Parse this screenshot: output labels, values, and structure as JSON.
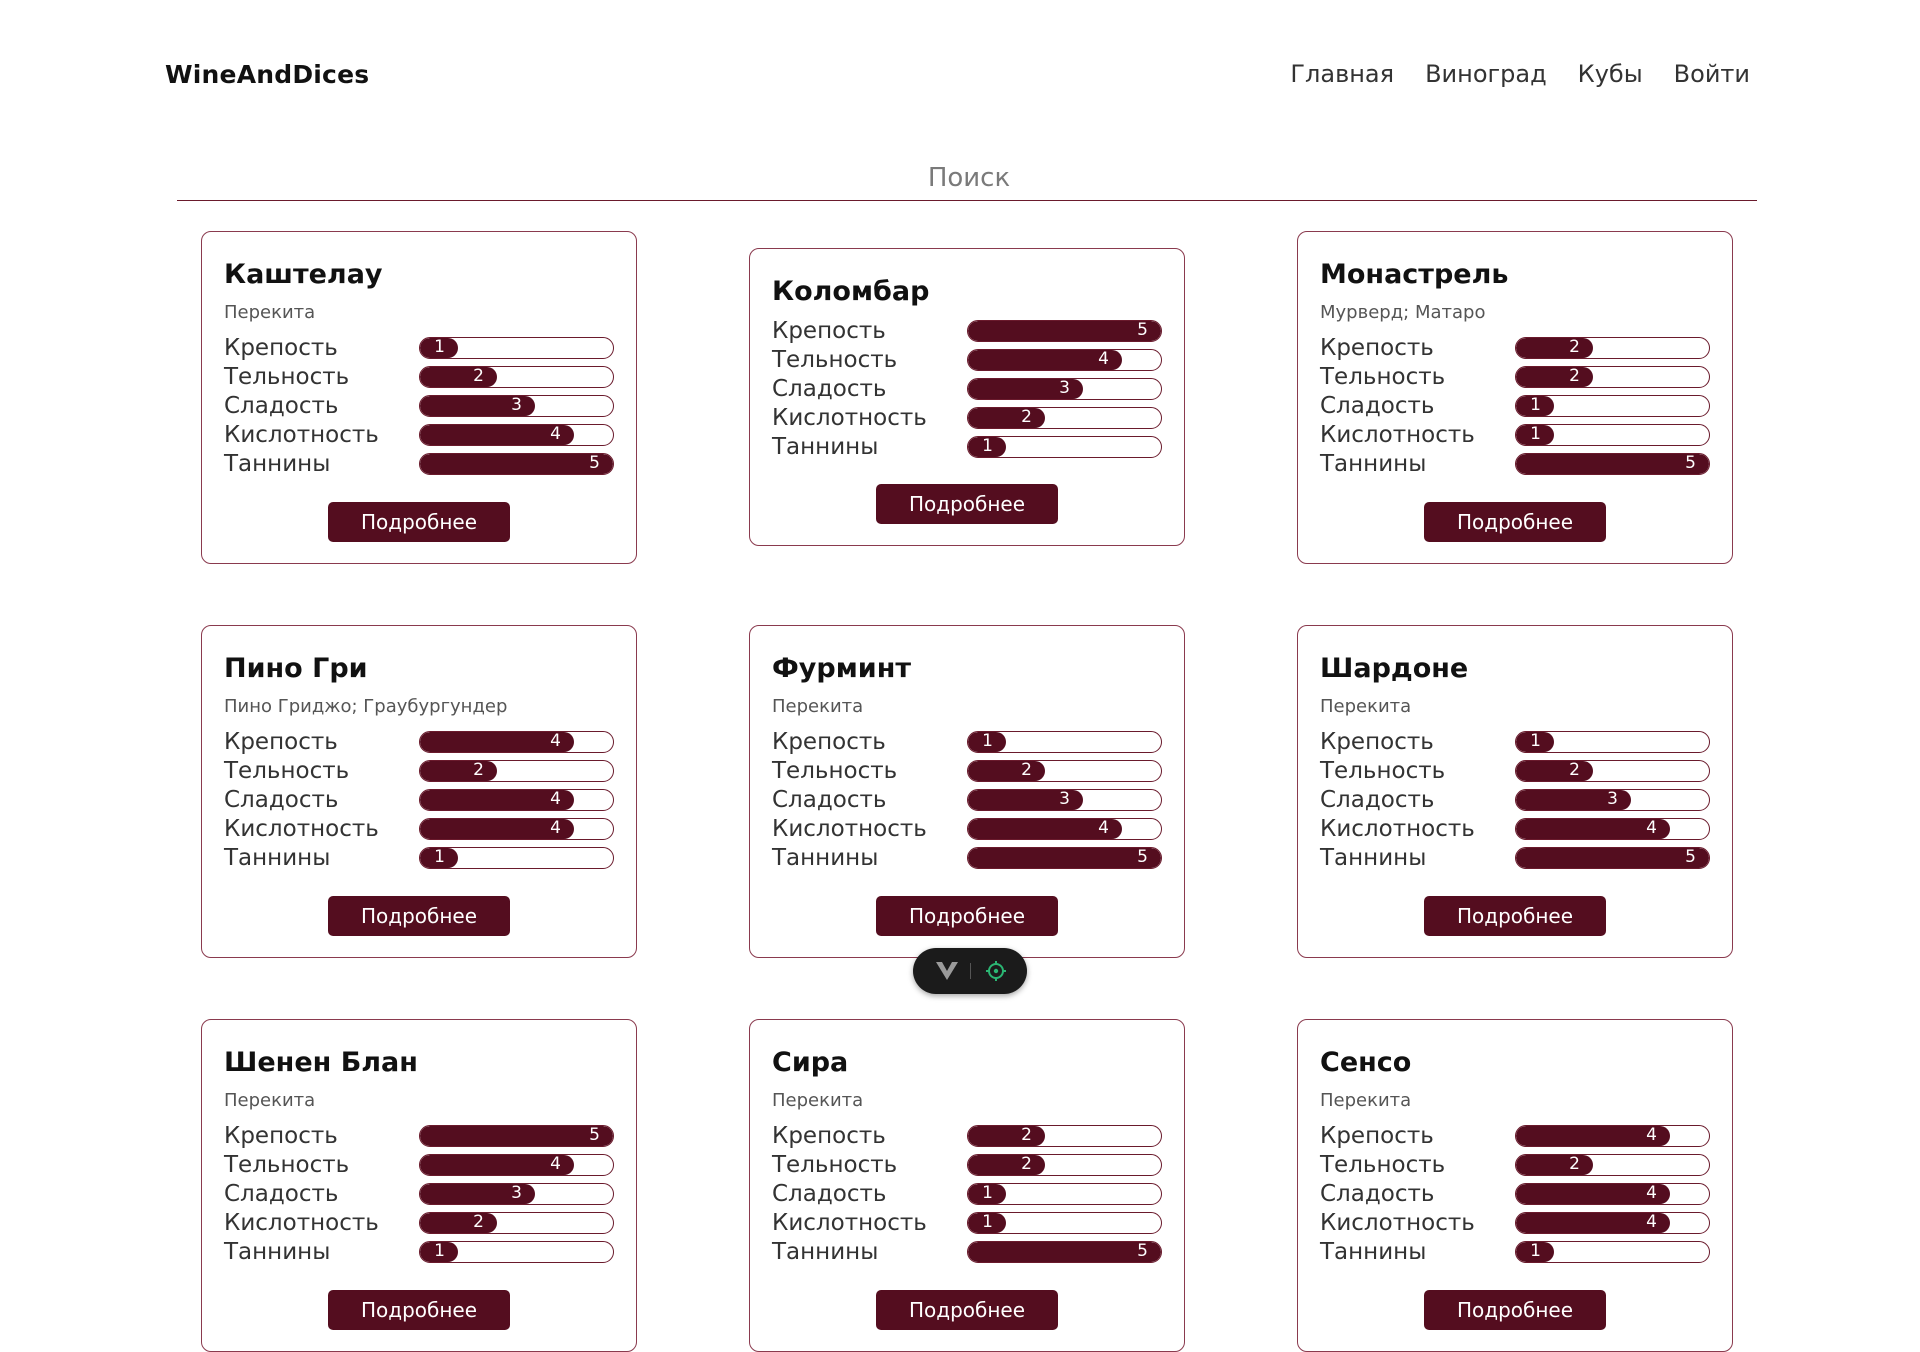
{
  "header": {
    "brand": "WineAndDices",
    "nav": [
      "Главная",
      "Виноград",
      "Кубы",
      "Войти"
    ]
  },
  "search": {
    "placeholder": "Поиск"
  },
  "stat_labels": [
    "Крепость",
    "Тельность",
    "Сладость",
    "Кислотность",
    "Таннины"
  ],
  "stat_max": 5,
  "button_label": "Подробнее",
  "cards": [
    {
      "name": "Каштелау",
      "synonyms": "Перекита",
      "stats": [
        1,
        2,
        3,
        4,
        5
      ]
    },
    {
      "name": "Коломбар",
      "synonyms": "",
      "stats": [
        5,
        4,
        3,
        2,
        1
      ]
    },
    {
      "name": "Монастрель",
      "synonyms": "Мурверд; Матаро",
      "stats": [
        2,
        2,
        1,
        1,
        5
      ]
    },
    {
      "name": "Пино Гри",
      "synonyms": "Пино Гриджо; Граубургундер",
      "stats": [
        4,
        2,
        4,
        4,
        1
      ]
    },
    {
      "name": "Фурминт",
      "synonyms": "Перекита",
      "stats": [
        1,
        2,
        3,
        4,
        5
      ]
    },
    {
      "name": "Шардоне",
      "synonyms": "Перекита",
      "stats": [
        1,
        2,
        3,
        4,
        5
      ]
    },
    {
      "name": "Шенен Блан",
      "synonyms": "Перекита",
      "stats": [
        5,
        4,
        3,
        2,
        1
      ]
    },
    {
      "name": "Сира",
      "synonyms": "Перекита",
      "stats": [
        2,
        2,
        1,
        1,
        5
      ]
    },
    {
      "name": "Сенсо",
      "synonyms": "Перекита",
      "stats": [
        4,
        2,
        4,
        4,
        1
      ]
    }
  ],
  "colors": {
    "accent": "#540d1f",
    "border": "#8a3a4e"
  },
  "devtools": {
    "icons": [
      "vue-logo-icon",
      "target-icon"
    ]
  }
}
